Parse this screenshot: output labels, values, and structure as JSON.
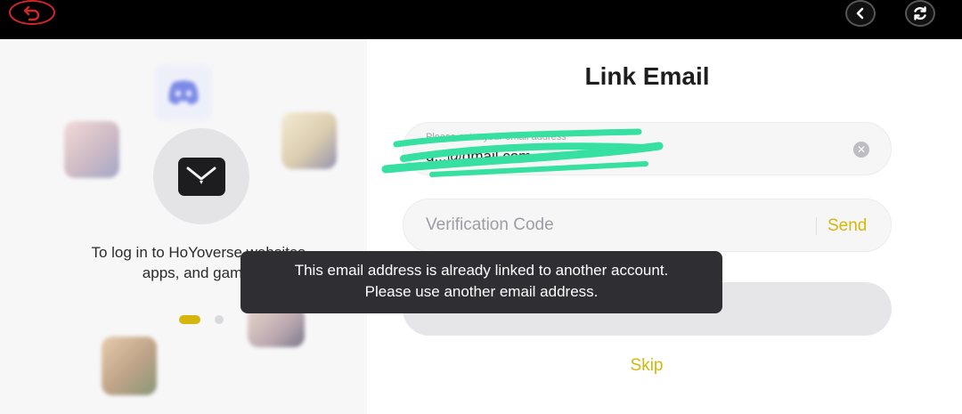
{
  "topbar": {
    "back_icon": "back-arrow-icon",
    "prev_icon": "chevron-left-icon",
    "refresh_icon": "refresh-icon",
    "back_color": "#d2262a"
  },
  "left_panel": {
    "caption": "To log in to HoYoverse websites, apps, and games",
    "carousel_active_index": 0,
    "carousel_count": 2,
    "accent_color": "#d4b60c"
  },
  "form": {
    "title": "Link Email",
    "email": {
      "placeholder": "Please enter your email address",
      "value": "g...@gmail.com"
    },
    "verification": {
      "placeholder": "Verification Code",
      "send_label": "Send"
    },
    "next_label": "Next",
    "skip_label": "Skip"
  },
  "toast": {
    "line1": "This email address is already linked to another account.",
    "line2": "Please use another email address."
  }
}
